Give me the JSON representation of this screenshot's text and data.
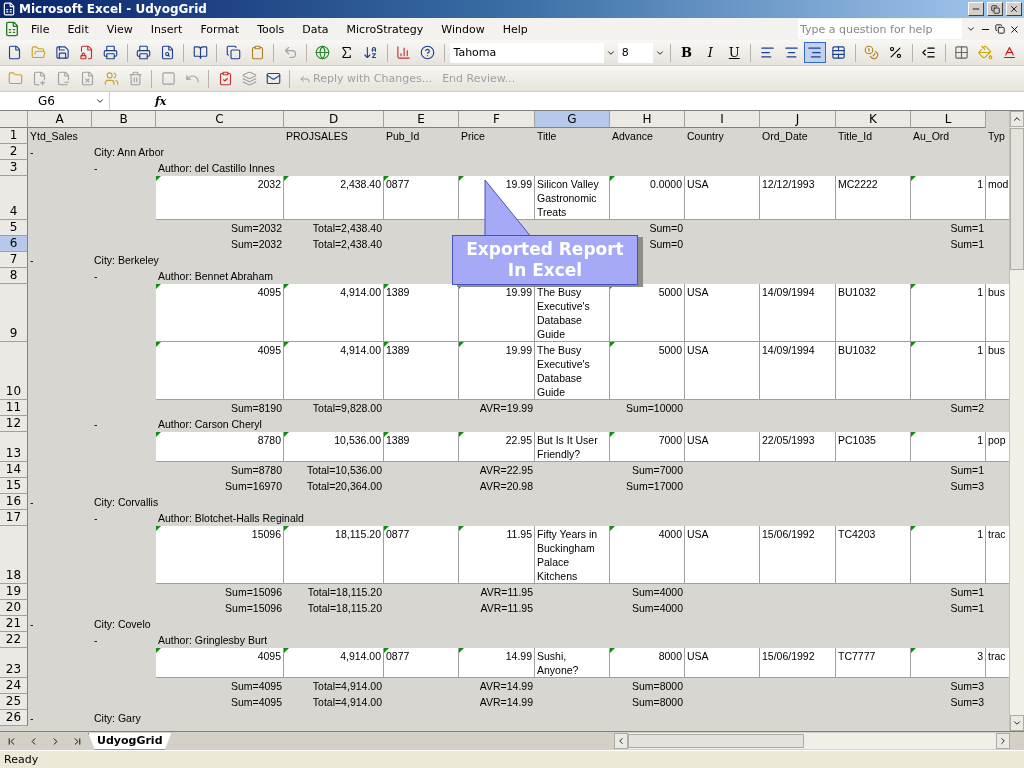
{
  "window": {
    "title": "Microsoft Excel - UdyogGrid"
  },
  "menu": [
    "File",
    "Edit",
    "View",
    "Insert",
    "Format",
    "Tools",
    "Data",
    "MicroStrategy",
    "Window",
    "Help"
  ],
  "help_box": {
    "placeholder": "Type a question for help"
  },
  "formatting": {
    "font": "Tahoma",
    "size": "8",
    "styles": [
      {
        "label": "B",
        "selected": false
      },
      {
        "label": "I",
        "selected": false
      },
      {
        "label": "U",
        "selected": false
      }
    ],
    "alignment": [
      {
        "selected": false
      },
      {
        "selected": false
      },
      {
        "selected": true
      }
    ]
  },
  "review_toolbar": {
    "buttons": [
      {
        "label": "Reply with Changes...",
        "disabled": true
      },
      {
        "label": "End Review...",
        "disabled": true
      }
    ]
  },
  "formula_bar": {
    "name_box": "G6",
    "function_label": "fx"
  },
  "columns": [
    {
      "letter": "A",
      "selected": false
    },
    {
      "letter": "B",
      "selected": false
    },
    {
      "letter": "C",
      "selected": false
    },
    {
      "letter": "D",
      "selected": false
    },
    {
      "letter": "E",
      "selected": false
    },
    {
      "letter": "F",
      "selected": false
    },
    {
      "letter": "G",
      "selected": true
    },
    {
      "letter": "H",
      "selected": false
    },
    {
      "letter": "I",
      "selected": false
    },
    {
      "letter": "J",
      "selected": false
    },
    {
      "letter": "K",
      "selected": false
    },
    {
      "letter": "L",
      "selected": false
    }
  ],
  "rows": [
    {
      "number": "1",
      "selected": false,
      "kind": "header",
      "cells": {
        "A": "Ytd_Sales",
        "D": "PROJSALES",
        "E": "Pub_Id",
        "F": "Price",
        "G": "Title",
        "H": "Advance",
        "I": "Country",
        "J": "Ord_Date",
        "K": "Title_Id",
        "L": "Au_Ord",
        "M": "Typ"
      }
    },
    {
      "number": "2",
      "selected": false,
      "kind": "city",
      "cells": {
        "A": "-",
        "B": "City: Ann Arbor"
      }
    },
    {
      "number": "3",
      "selected": false,
      "kind": "author",
      "cells": {
        "B": "-",
        "C": "Author: del Castillo Innes"
      }
    },
    {
      "number": "4",
      "selected": false,
      "kind": "detail",
      "cells": {
        "C": {
          "text": "2032",
          "flagged": true
        },
        "D": {
          "text": "2,438.40",
          "flagged": true
        },
        "E": {
          "text": "0877",
          "flagged": true
        },
        "F": {
          "text": "19.99",
          "flagged": true
        },
        "G": {
          "text": "Silicon Valley Gastronomic Treats",
          "flagged": false
        },
        "H": {
          "text": "0.0000",
          "flagged": true
        },
        "I": {
          "text": "USA",
          "flagged": false
        },
        "J": {
          "text": "12/12/1993",
          "flagged": false
        },
        "K": {
          "text": "MC2222",
          "flagged": false
        },
        "L": {
          "text": "1",
          "flagged": true
        },
        "M": {
          "text": "mod",
          "flagged": false
        }
      }
    },
    {
      "number": "5",
      "selected": false,
      "kind": "total",
      "cells": {
        "C": "Sum=2032",
        "D": "Total=2,438.40",
        "H": "Sum=0",
        "L": "Sum=1"
      }
    },
    {
      "number": "6",
      "selected": true,
      "kind": "total",
      "cells": {
        "C": "Sum=2032",
        "D": "Total=2,438.40",
        "H": "Sum=0",
        "L": "Sum=1"
      }
    },
    {
      "number": "7",
      "selected": false,
      "kind": "city",
      "cells": {
        "A": "-",
        "B": "City: Berkeley"
      }
    },
    {
      "number": "8",
      "selected": false,
      "kind": "author",
      "cells": {
        "B": "-",
        "C": "Author: Bennet Abraham"
      }
    },
    {
      "number": "9",
      "selected": false,
      "kind": "detail",
      "cells": {
        "C": {
          "text": "4095",
          "flagged": true
        },
        "D": {
          "text": "4,914.00",
          "flagged": true
        },
        "E": {
          "text": "1389",
          "flagged": true
        },
        "F": {
          "text": "19.99",
          "flagged": true
        },
        "G": {
          "text": "The Busy Executive's Database Guide",
          "flagged": false
        },
        "H": {
          "text": "5000",
          "flagged": true
        },
        "I": {
          "text": "USA",
          "flagged": false
        },
        "J": {
          "text": "14/09/1994",
          "flagged": false
        },
        "K": {
          "text": "BU1032",
          "flagged": false
        },
        "L": {
          "text": "1",
          "flagged": true
        },
        "M": {
          "text": "bus",
          "flagged": false
        }
      }
    },
    {
      "number": "10",
      "selected": false,
      "kind": "detail",
      "cells": {
        "C": {
          "text": "4095",
          "flagged": true
        },
        "D": {
          "text": "4,914.00",
          "flagged": true
        },
        "E": {
          "text": "1389",
          "flagged": true
        },
        "F": {
          "text": "19.99",
          "flagged": true
        },
        "G": {
          "text": "The Busy Executive's Database Guide",
          "flagged": false
        },
        "H": {
          "text": "5000",
          "flagged": true
        },
        "I": {
          "text": "USA",
          "flagged": false
        },
        "J": {
          "text": "14/09/1994",
          "flagged": false
        },
        "K": {
          "text": "BU1032",
          "flagged": false
        },
        "L": {
          "text": "1",
          "flagged": true
        },
        "M": {
          "text": "bus",
          "flagged": false
        }
      }
    },
    {
      "number": "11",
      "selected": false,
      "kind": "total",
      "cells": {
        "C": "Sum=8190",
        "D": "Total=9,828.00",
        "F": "AVR=19.99",
        "H": "Sum=10000",
        "L": "Sum=2"
      }
    },
    {
      "number": "12",
      "selected": false,
      "kind": "author",
      "cells": {
        "B": "-",
        "C": "Author: Carson Cheryl"
      }
    },
    {
      "number": "13",
      "selected": false,
      "kind": "detail",
      "cells": {
        "C": {
          "text": "8780",
          "flagged": true
        },
        "D": {
          "text": "10,536.00",
          "flagged": true
        },
        "E": {
          "text": "1389",
          "flagged": true
        },
        "F": {
          "text": "22.95",
          "flagged": true
        },
        "G": {
          "text": "But Is It User Friendly?",
          "flagged": false
        },
        "H": {
          "text": "7000",
          "flagged": true
        },
        "I": {
          "text": "USA",
          "flagged": false
        },
        "J": {
          "text": "22/05/1993",
          "flagged": false
        },
        "K": {
          "text": "PC1035",
          "flagged": false
        },
        "L": {
          "text": "1",
          "flagged": true
        },
        "M": {
          "text": "pop",
          "flagged": false
        }
      }
    },
    {
      "number": "14",
      "selected": false,
      "kind": "total",
      "cells": {
        "C": "Sum=8780",
        "D": "Total=10,536.00",
        "F": "AVR=22.95",
        "H": "Sum=7000",
        "L": "Sum=1"
      }
    },
    {
      "number": "15",
      "selected": false,
      "kind": "total",
      "cells": {
        "C": "Sum=16970",
        "D": "Total=20,364.00",
        "F": "AVR=20.98",
        "H": "Sum=17000",
        "L": "Sum=3"
      }
    },
    {
      "number": "16",
      "selected": false,
      "kind": "city",
      "cells": {
        "A": "-",
        "B": "City: Corvallis"
      }
    },
    {
      "number": "17",
      "selected": false,
      "kind": "author",
      "cells": {
        "B": "-",
        "C": "Author: Blotchet-Halls Reginald"
      }
    },
    {
      "number": "18",
      "selected": false,
      "kind": "detail",
      "cells": {
        "C": {
          "text": "15096",
          "flagged": true
        },
        "D": {
          "text": "18,115.20",
          "flagged": true
        },
        "E": {
          "text": "0877",
          "flagged": true
        },
        "F": {
          "text": "11.95",
          "flagged": true
        },
        "G": {
          "text": "Fifty Years in Buckingham Palace Kitchens",
          "flagged": false
        },
        "H": {
          "text": "4000",
          "flagged": true
        },
        "I": {
          "text": "USA",
          "flagged": false
        },
        "J": {
          "text": "15/06/1992",
          "flagged": false
        },
        "K": {
          "text": "TC4203",
          "flagged": false
        },
        "L": {
          "text": "1",
          "flagged": true
        },
        "M": {
          "text": "trac",
          "flagged": false
        }
      }
    },
    {
      "number": "19",
      "selected": false,
      "kind": "total",
      "cells": {
        "C": "Sum=15096",
        "D": "Total=18,115.20",
        "F": "AVR=11.95",
        "H": "Sum=4000",
        "L": "Sum=1"
      }
    },
    {
      "number": "20",
      "selected": false,
      "kind": "total",
      "cells": {
        "C": "Sum=15096",
        "D": "Total=18,115.20",
        "F": "AVR=11.95",
        "H": "Sum=4000",
        "L": "Sum=1"
      }
    },
    {
      "number": "21",
      "selected": false,
      "kind": "city",
      "cells": {
        "A": "-",
        "B": "City: Covelo"
      }
    },
    {
      "number": "22",
      "selected": false,
      "kind": "author",
      "cells": {
        "B": "-",
        "C": "Author: Gringlesby Burt"
      }
    },
    {
      "number": "23",
      "selected": false,
      "kind": "detail",
      "cells": {
        "C": {
          "text": "4095",
          "flagged": true
        },
        "D": {
          "text": "4,914.00",
          "flagged": true
        },
        "E": {
          "text": "0877",
          "flagged": true
        },
        "F": {
          "text": "14.99",
          "flagged": true
        },
        "G": {
          "text": "Sushi, Anyone?",
          "flagged": false
        },
        "H": {
          "text": "8000",
          "flagged": true
        },
        "I": {
          "text": "USA",
          "flagged": false
        },
        "J": {
          "text": "15/06/1992",
          "flagged": false
        },
        "K": {
          "text": "TC7777",
          "flagged": false
        },
        "L": {
          "text": "3",
          "flagged": true
        },
        "M": {
          "text": "trac",
          "flagged": false
        }
      }
    },
    {
      "number": "24",
      "selected": false,
      "kind": "total",
      "cells": {
        "C": "Sum=4095",
        "D": "Total=4,914.00",
        "F": "AVR=14.99",
        "H": "Sum=8000",
        "L": "Sum=3"
      }
    },
    {
      "number": "25",
      "selected": false,
      "kind": "total",
      "cells": {
        "C": "Sum=4095",
        "D": "Total=4,914.00",
        "F": "AVR=14.99",
        "H": "Sum=8000",
        "L": "Sum=3"
      }
    },
    {
      "number": "26",
      "selected": false,
      "kind": "city",
      "cells": {
        "A": "-",
        "B": "City: Gary"
      }
    }
  ],
  "callout": {
    "text": "Exported Report In Excel"
  },
  "sheet_tabs": [
    {
      "label": "UdyogGrid",
      "selected": true
    }
  ],
  "status_bar": {
    "text": "Ready"
  }
}
